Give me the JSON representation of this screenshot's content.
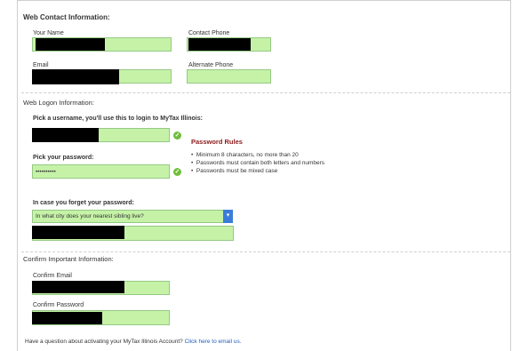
{
  "web_contact": {
    "heading": "Web Contact Information:",
    "your_name_label": "Your Name",
    "contact_phone_label": "Contact Phone",
    "email_label": "Email",
    "alternate_phone_label": "Alternate Phone"
  },
  "web_logon": {
    "heading": "Web Logon Information:",
    "username_label": "Pick a username, you'll use this to login to MyTax Illinois:",
    "password_label": "Pick your password:",
    "password_value": "••••••••••",
    "password_rules": {
      "title": "Password Rules",
      "rules": [
        "Minimum 8 characters, no more than 20",
        "Passwords must contain both letters and numbers",
        "Passwords must be mixed case"
      ]
    },
    "forgot_label": "In case you forget your password:",
    "security_question_selected": "In what city does your nearest sibling live?"
  },
  "confirm": {
    "heading": "Confirm Important Information:",
    "confirm_email_label": "Confirm Email",
    "confirm_password_label": "Confirm Password"
  },
  "footer": {
    "question_text": "Have a question about activating your MyTax Illinois Account?",
    "email_link": "Click here to email us."
  }
}
